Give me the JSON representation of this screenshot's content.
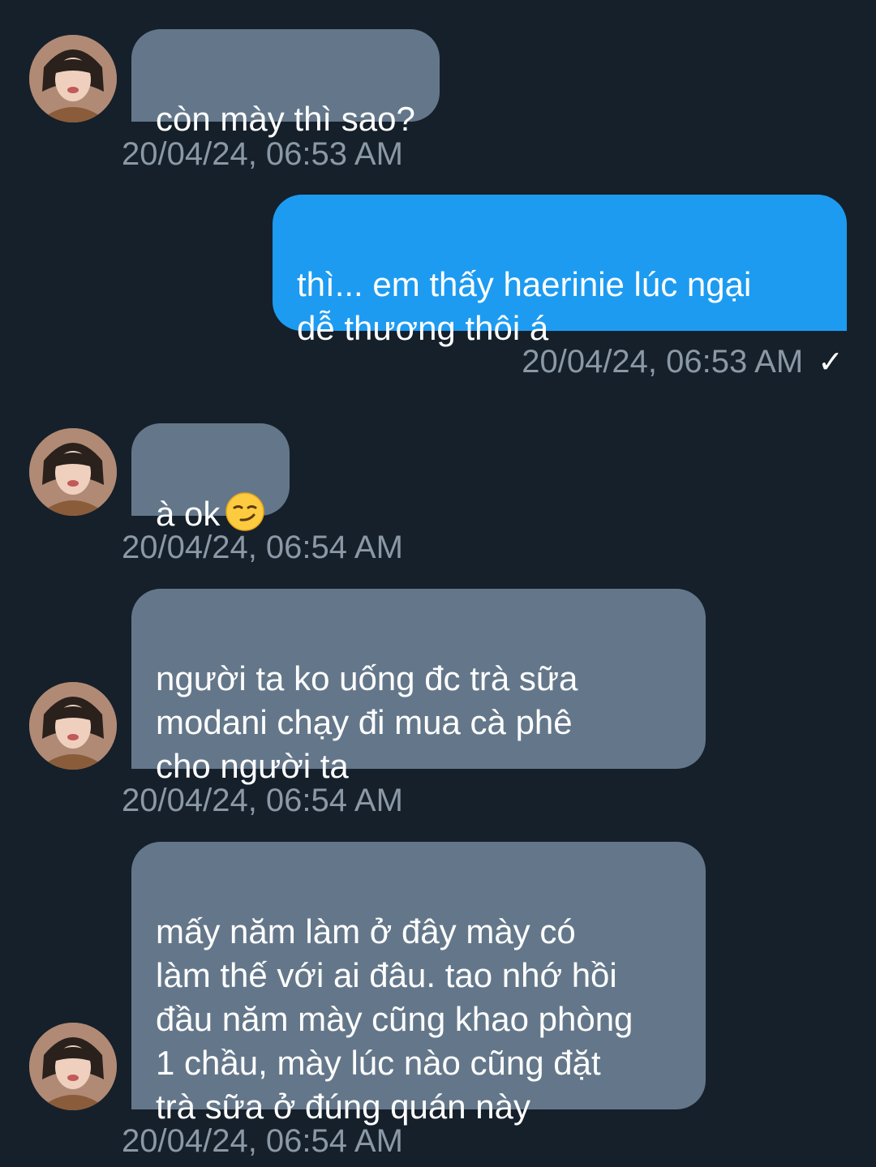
{
  "messages": [
    {
      "from": "them",
      "text": "còn mày thì sao?",
      "time": "20/04/24, 06:53 AM"
    },
    {
      "from": "me",
      "text": "thì... em thấy haerinie lúc ngại\ndễ thương thôi á",
      "time": "20/04/24, 06:53 AM",
      "status_icon": "check-icon"
    },
    {
      "from": "them",
      "text": "à ok",
      "emoji": "smirking-face-emoji",
      "time": "20/04/24, 06:54 AM"
    },
    {
      "from": "them",
      "text": "người ta ko uống đc trà sữa\nmodani chạy đi mua cà phê\ncho người ta",
      "time": "20/04/24, 06:54 AM"
    },
    {
      "from": "them",
      "text": "mấy năm làm ở đây mày có\nlàm thế với ai đâu. tao nhớ hồi\nđầu năm mày cũng khao phòng\n1 chầu, mày lúc nào cũng đặt\ntrà sữa ở đúng quán này",
      "time": "20/04/24, 06:54 AM"
    }
  ],
  "colors": {
    "background": "#15202b",
    "incoming_bubble": "#64778a",
    "outgoing_bubble": "#1d9bf0",
    "timestamp": "#8b98a5",
    "text": "#ffffff"
  }
}
